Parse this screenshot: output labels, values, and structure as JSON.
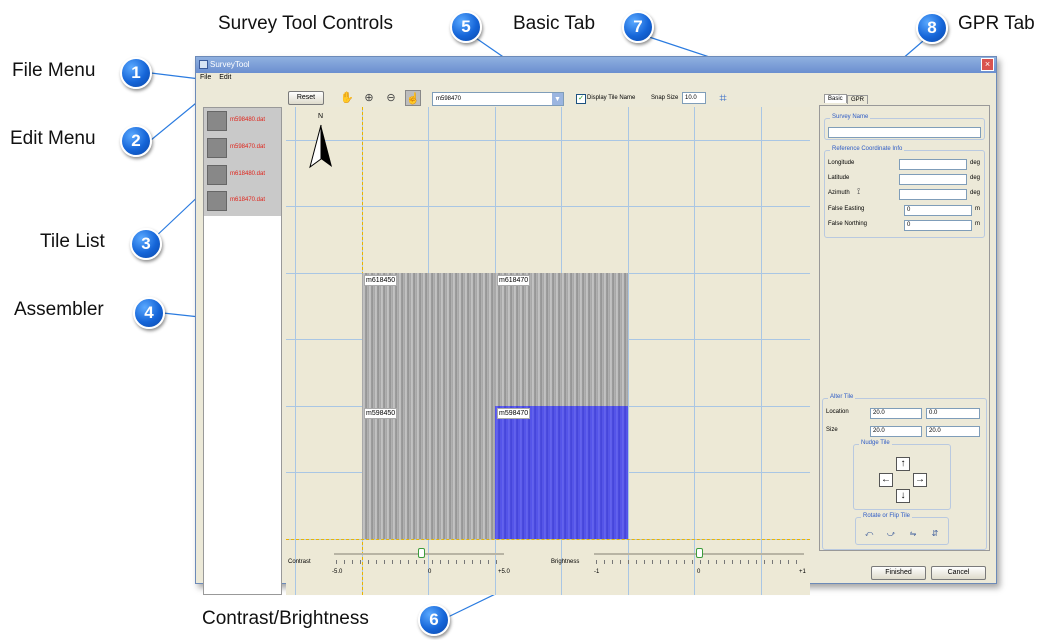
{
  "callouts": {
    "file_menu": {
      "label": "File Menu",
      "number": "1"
    },
    "edit_menu": {
      "label": "Edit Menu",
      "number": "2"
    },
    "tile_list": {
      "label": "Tile List",
      "number": "3"
    },
    "assembler": {
      "label": "Assembler",
      "number": "4"
    },
    "survey_tool_controls": {
      "label": "Survey Tool Controls",
      "number": "5"
    },
    "contrast_brightness": {
      "label": "Contrast/Brightness",
      "number": "6"
    },
    "basic_tab": {
      "label": "Basic Tab",
      "number": "7"
    },
    "gpr_tab": {
      "label": "GPR Tab",
      "number": "8"
    }
  },
  "window": {
    "title": "SurveyTool",
    "close": "×"
  },
  "menubar": {
    "file": "File",
    "edit": "Edit"
  },
  "toolbar": {
    "reset_label": "Reset",
    "tile_combo_value": "m598470",
    "display_tile_name_label": "Display Tile Name",
    "display_tile_name_checked": "✓",
    "snap_size_label": "Snap Size",
    "snap_size_value": "10.0"
  },
  "tile_list": {
    "items": [
      {
        "name": "m598480.dat"
      },
      {
        "name": "m598470.dat"
      },
      {
        "name": "m618480.dat"
      },
      {
        "name": "m618470.dat"
      }
    ]
  },
  "assembler": {
    "north_label": "N",
    "tiles": [
      {
        "name": "m618450"
      },
      {
        "name": "m618470"
      },
      {
        "name": "m598450"
      },
      {
        "name": "m598470"
      }
    ]
  },
  "tabs": {
    "basic": "Basic",
    "gpr": "GPR"
  },
  "basic_tab": {
    "survey_name_title": "Survey Name",
    "survey_name_value": "",
    "ref_title": "Reference Coordinate Info",
    "longitude_label": "Longitude",
    "latitude_label": "Latitude",
    "azimuth_label": "Azimuth",
    "false_easting_label": "False Easting",
    "false_northing_label": "False Northing",
    "longitude_value": "",
    "latitude_value": "",
    "azimuth_value": "",
    "false_easting_value": "0",
    "false_northing_value": "0",
    "deg_unit": "deg",
    "m_unit": "m",
    "alter_tile_title": "Alter Tile",
    "location_label": "Location",
    "location_x": "20.0",
    "location_y": "0.0",
    "size_label": "Size",
    "size_x": "20.0",
    "size_y": "20.0",
    "nudge_title": "Nudge Tile",
    "rotate_title": "Rotate or Flip Tile"
  },
  "sliders": {
    "contrast_label": "Contrast",
    "contrast_min": "-5.0",
    "contrast_mid": "0",
    "contrast_max": "+5.0",
    "contrast_value": 0.1,
    "brightness_label": "Brightness",
    "brightness_min": "-1",
    "brightness_mid": "0",
    "brightness_max": "+1",
    "brightness_value": 0
  },
  "buttons": {
    "finished": "Finished",
    "cancel": "Cancel"
  }
}
